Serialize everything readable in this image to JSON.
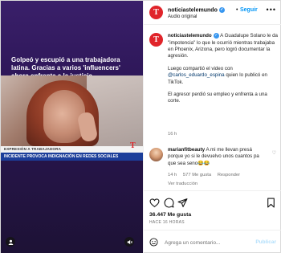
{
  "media": {
    "headline": "Golpeó y escupió a una trabajadora latina. Gracias a varios 'influencers' ahora enfrenta a la justicia",
    "chyron_small": "EXPRESIÓN A TRABAJADORA",
    "chyron_main": "INCIDENTE PROVOCA INDIGNACIÓN EN REDES SOCIALES",
    "logo_glyph": "T",
    "user_icon": "user-icon",
    "mute_icon": "mute-icon"
  },
  "header": {
    "username": "noticiastelemundo",
    "follow_label": "Seguir",
    "subtitle": "Audio original",
    "more_icon": "more-icon",
    "separator": "•"
  },
  "caption": {
    "username": "noticiastelemundo",
    "para1": "A Guadalupe Solano le da \"impotencia\" lo que le ocurrió mientras trabajaba en Phoenix, Arizona, pero logró documentar la agresión.",
    "para2_before": "Luego compartió el video con",
    "mention": "@carlos_eduardo_espina",
    "para2_after": "quien lo publicó en TikTok.",
    "para3": "El agresor perdió su empleo y enfrenta a una corte.",
    "time": "16 h"
  },
  "comment": {
    "username": "marianfitbeauty",
    "text": "A mi me llevan presá porque yo si le devuelvo unos cuantos pa que sea seno😂😂",
    "time": "14 h",
    "likes": "577 Me gusta",
    "reply": "Responder",
    "translation": "Ver traducción"
  },
  "actions": {
    "likes": "36.447 Me gusta",
    "ago": "HACE 16 HORAS",
    "comment_placeholder": "Agrega un comentario...",
    "publish_label": "Publicar"
  },
  "colors": {
    "accent": "#0095f6",
    "brand": "#e0242a",
    "chyron_blue": "#1c3e9a"
  }
}
